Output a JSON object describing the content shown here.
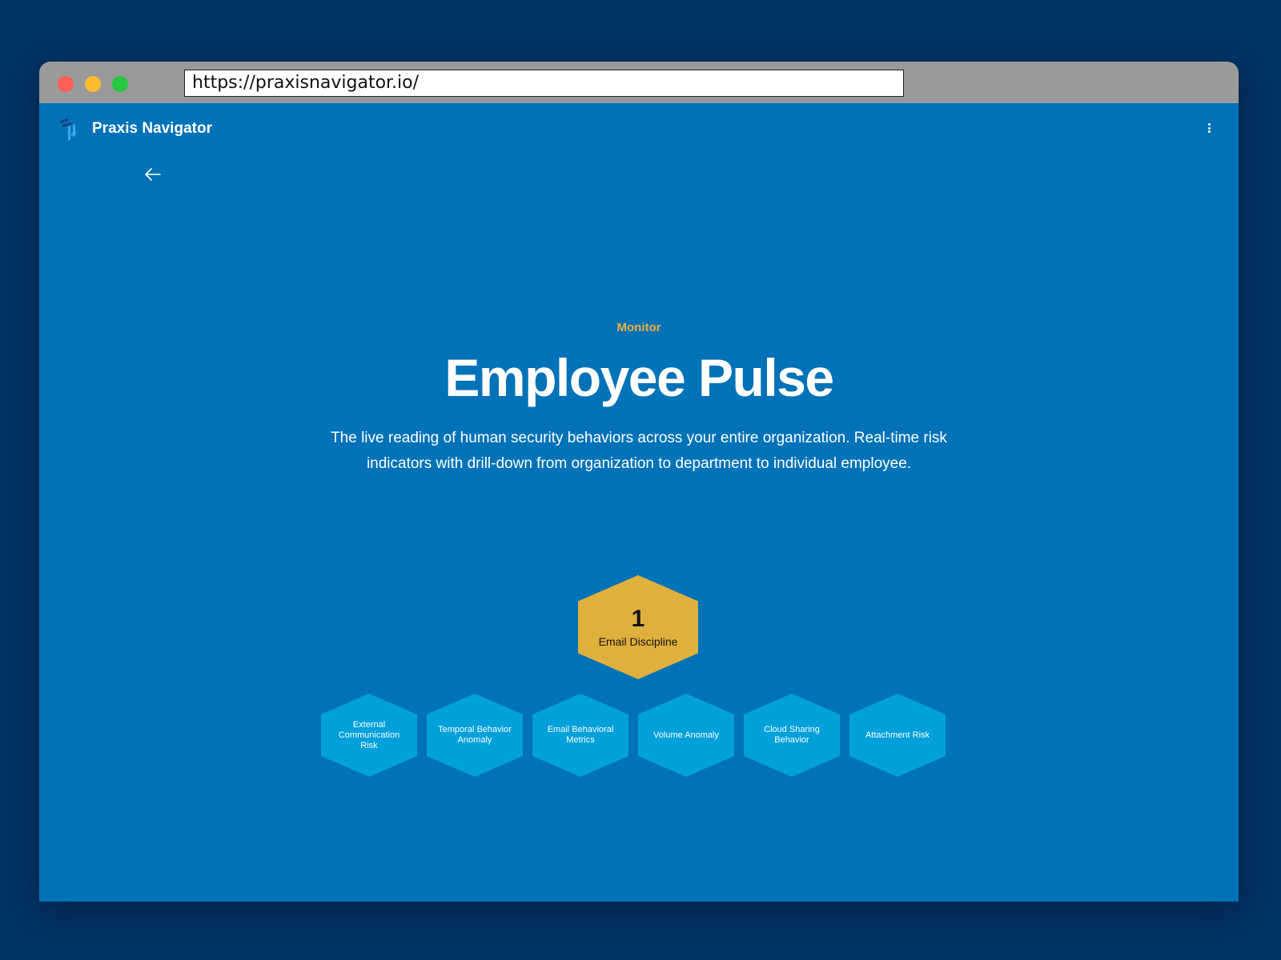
{
  "browser": {
    "url": "https://praxisnavigator.io/"
  },
  "nav": {
    "brand": "Praxis Navigator",
    "logo_icon": "praxis-logo-icon",
    "menu_icon": "kebab-menu-icon"
  },
  "hero": {
    "back_icon": "arrow-left-icon",
    "eyebrow": "Monitor",
    "title": "Employee Pulse",
    "description": "The live reading of human security behaviors across your entire organization. Real-time risk indicators with drill-down from organization to department to individual employee."
  },
  "pillar": {
    "number": "1",
    "label": "Email Discipline",
    "color": "#e0b03c"
  },
  "indicators": [
    {
      "label": "External Communication Risk"
    },
    {
      "label": "Temporal Behavior Anomaly"
    },
    {
      "label": "Email Behavioral Metrics"
    },
    {
      "label": "Volume Anomaly"
    },
    {
      "label": "Cloud Sharing Behavior"
    },
    {
      "label": "Attachment Risk"
    }
  ],
  "colors": {
    "background": "#003366",
    "page": "#0072b8",
    "accent": "#f0b23a",
    "indicator": "#00a0db"
  }
}
